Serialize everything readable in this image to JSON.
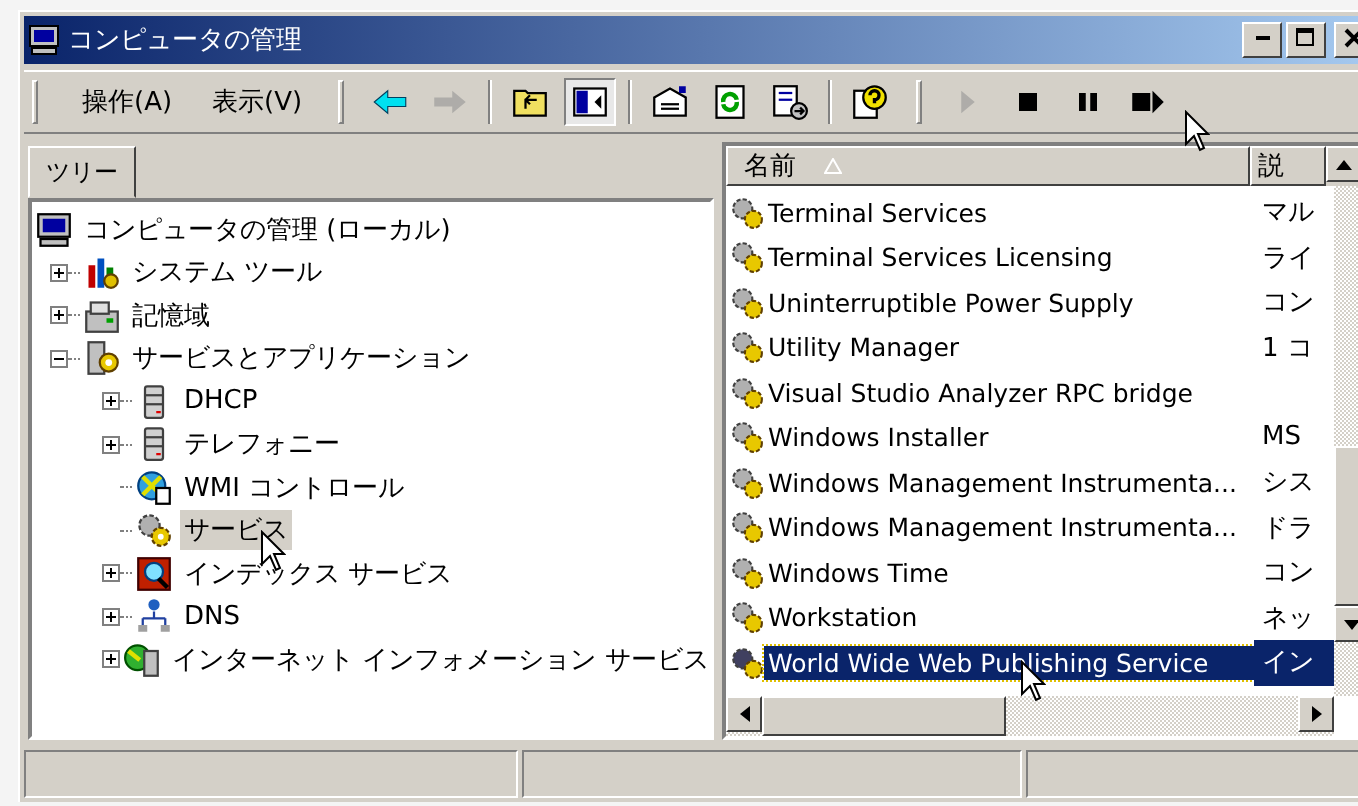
{
  "window": {
    "title": "コンピュータの管理"
  },
  "menu": [
    {
      "label": "操作(A)"
    },
    {
      "label": "表示(V)"
    }
  ],
  "toolbar": [
    {
      "kind": "back",
      "disabled": false,
      "pressed": false
    },
    {
      "kind": "forward",
      "disabled": true,
      "pressed": false
    },
    {
      "kind": "sep"
    },
    {
      "kind": "up",
      "disabled": false,
      "pressed": false
    },
    {
      "kind": "tree",
      "disabled": false,
      "pressed": true
    },
    {
      "kind": "sep"
    },
    {
      "kind": "properties",
      "disabled": false,
      "pressed": false
    },
    {
      "kind": "refresh",
      "disabled": false,
      "pressed": false
    },
    {
      "kind": "export",
      "disabled": false,
      "pressed": false
    },
    {
      "kind": "sep"
    },
    {
      "kind": "help",
      "disabled": false,
      "pressed": false
    },
    {
      "kind": "grip"
    },
    {
      "kind": "play",
      "disabled": true,
      "pressed": false
    },
    {
      "kind": "stop",
      "disabled": false,
      "pressed": false
    },
    {
      "kind": "pause",
      "disabled": false,
      "pressed": false
    },
    {
      "kind": "restart",
      "disabled": false,
      "pressed": false
    }
  ],
  "tree_tab": {
    "label": "ツリー"
  },
  "tree": [
    {
      "label": "コンピュータの管理 (ローカル)",
      "kind": "computer",
      "selected": false,
      "children": [
        {
          "label": "システム ツール",
          "kind": "tools",
          "selected": false,
          "expanded": false
        },
        {
          "label": "記憶域",
          "kind": "storage",
          "selected": false,
          "expanded": false
        },
        {
          "label": "サービスとアプリケーション",
          "kind": "services",
          "selected": false,
          "expanded": true,
          "children": [
            {
              "label": "DHCP",
              "kind": "server",
              "selected": false,
              "expanded": false
            },
            {
              "label": "テレフォニー",
              "kind": "server",
              "selected": false,
              "expanded": false
            },
            {
              "label": "WMI コントロール",
              "kind": "wmi",
              "selected": false
            },
            {
              "label": "サービス",
              "kind": "gear",
              "selected": true
            },
            {
              "label": "インデックス サービス",
              "kind": "index",
              "selected": false,
              "expanded": false
            },
            {
              "label": "DNS",
              "kind": "dns",
              "selected": false,
              "expanded": false
            },
            {
              "label": "インターネット インフォメーション サービス",
              "kind": "iis",
              "selected": false,
              "expanded": false
            }
          ]
        }
      ]
    }
  ],
  "list": {
    "columns": [
      {
        "label": "名前",
        "sorted": true
      },
      {
        "label": "説",
        "sorted": false
      }
    ],
    "rows": [
      {
        "name": "Terminal Services",
        "description": "マル",
        "selected": false
      },
      {
        "name": "Terminal Services Licensing",
        "description": "ライ",
        "selected": false
      },
      {
        "name": "Uninterruptible Power Supply",
        "description": "コン",
        "selected": false
      },
      {
        "name": "Utility Manager",
        "description": "1 コ",
        "selected": false
      },
      {
        "name": "Visual Studio Analyzer RPC bridge",
        "selected": false
      },
      {
        "name": "Windows Installer",
        "description": "MS",
        "selected": false
      },
      {
        "name": "Windows Management Instrumenta...",
        "description": "シス",
        "selected": false
      },
      {
        "name": "Windows Management Instrumenta...",
        "description": "ドラ",
        "selected": false
      },
      {
        "name": "Windows Time",
        "description": "コン",
        "selected": false
      },
      {
        "name": "Workstation",
        "description": "ネッ",
        "selected": false
      },
      {
        "name": "World Wide Web Publishing Service",
        "description": "イン",
        "selected": true
      }
    ]
  }
}
